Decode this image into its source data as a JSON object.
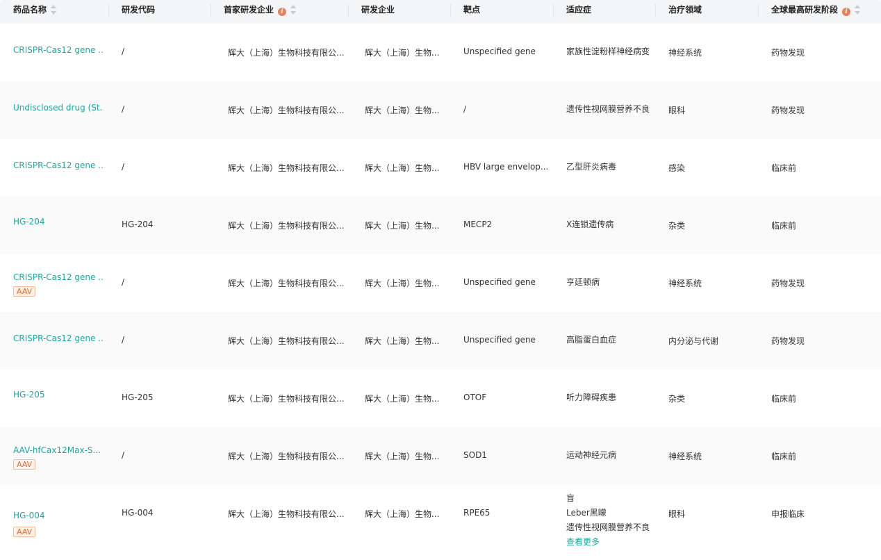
{
  "columns": [
    {
      "label": "药品名称",
      "sortable": true,
      "info": false
    },
    {
      "label": "研发代码",
      "sortable": false,
      "info": false
    },
    {
      "label": "首家研发企业",
      "sortable": true,
      "info": true
    },
    {
      "label": "研发企业",
      "sortable": false,
      "info": false
    },
    {
      "label": "靶点",
      "sortable": false,
      "info": false
    },
    {
      "label": "适应症",
      "sortable": false,
      "info": false
    },
    {
      "label": "治疗领域",
      "sortable": false,
      "info": false
    },
    {
      "label": "全球最高研发阶段",
      "sortable": true,
      "info": true
    }
  ],
  "rows": [
    {
      "drug": "CRISPR-Cas12 gene ...",
      "tag": "",
      "code": "/",
      "first_company": "辉大（上海）生物科技有限公...",
      "company": "辉大（上海）生物...",
      "target": "Unspecified gene",
      "indication": [
        "家族性淀粉样神经病变"
      ],
      "more": "",
      "area": "神经系统",
      "stage": "药物发现"
    },
    {
      "drug": "Undisclosed drug (St...",
      "tag": "",
      "code": "/",
      "first_company": "辉大（上海）生物科技有限公...",
      "company": "辉大（上海）生物...",
      "target": "/",
      "indication": [
        "遗传性视网膜营养不良"
      ],
      "more": "",
      "area": "眼科",
      "stage": "药物发现"
    },
    {
      "drug": "CRISPR-Cas12 gene ...",
      "tag": "",
      "code": "/",
      "first_company": "辉大（上海）生物科技有限公...",
      "company": "辉大（上海）生物...",
      "target": "HBV large envelop...",
      "indication": [
        "乙型肝炎病毒"
      ],
      "more": "",
      "area": "感染",
      "stage": "临床前"
    },
    {
      "drug": "HG-204",
      "tag": "",
      "code": "HG-204",
      "first_company": "辉大（上海）生物科技有限公...",
      "company": "辉大（上海）生物...",
      "target": "MECP2",
      "indication": [
        "X连锁遗传病"
      ],
      "more": "",
      "area": "杂类",
      "stage": "临床前"
    },
    {
      "drug": "CRISPR-Cas12 gene ...",
      "tag": "AAV",
      "code": "/",
      "first_company": "辉大（上海）生物科技有限公...",
      "company": "辉大（上海）生物...",
      "target": "Unspecified gene",
      "indication": [
        "亨廷顿病"
      ],
      "more": "",
      "area": "神经系统",
      "stage": "药物发现"
    },
    {
      "drug": "CRISPR-Cas12 gene ...",
      "tag": "",
      "code": "/",
      "first_company": "辉大（上海）生物科技有限公...",
      "company": "辉大（上海）生物...",
      "target": "Unspecified gene",
      "indication": [
        "高脂蛋白血症"
      ],
      "more": "",
      "area": "内分泌与代谢",
      "stage": "药物发现"
    },
    {
      "drug": "HG-205",
      "tag": "",
      "code": "HG-205",
      "first_company": "辉大（上海）生物科技有限公...",
      "company": "辉大（上海）生物...",
      "target": "OTOF",
      "indication": [
        "听力障碍疾患"
      ],
      "more": "",
      "area": "杂类",
      "stage": "临床前"
    },
    {
      "drug": "AAV-hfCax12Max-S...",
      "tag": "AAV",
      "code": "/",
      "first_company": "辉大（上海）生物科技有限公...",
      "company": "辉大（上海）生物...",
      "target": "SOD1",
      "indication": [
        "运动神经元病"
      ],
      "more": "",
      "area": "神经系统",
      "stage": "临床前"
    },
    {
      "drug": "HG-004",
      "tag": "AAV",
      "code": "HG-004",
      "first_company": "辉大（上海）生物科技有限公...",
      "company": "辉大（上海）生物...",
      "target": "RPE65",
      "indication": [
        "盲",
        "Leber黑矇",
        "遗传性视网膜营养不良"
      ],
      "more": "查看更多",
      "area": "眼科",
      "stage": "申报临床"
    }
  ]
}
